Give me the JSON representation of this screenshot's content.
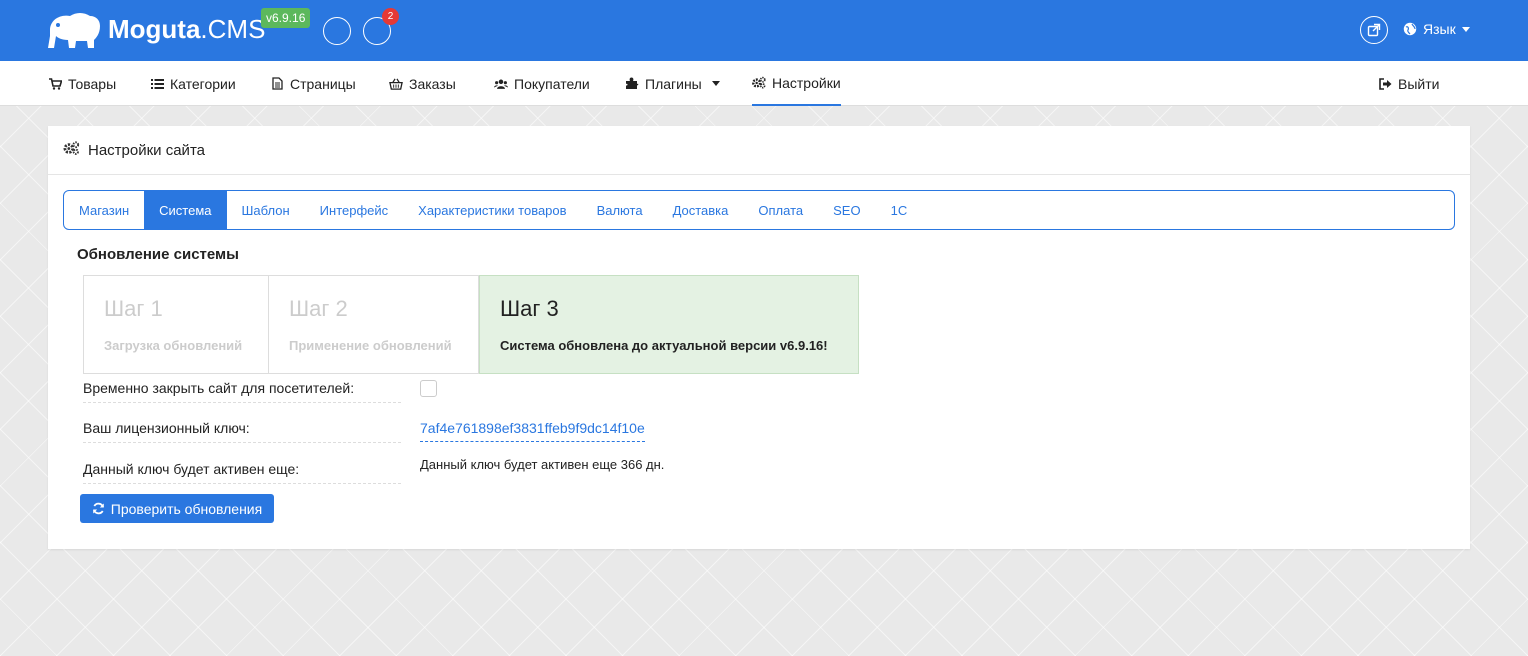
{
  "header": {
    "brand_bold": "Moguta",
    "brand_thin": ".CMS",
    "version": "v6.9.16",
    "notification_count": "2",
    "language_label": "Язык"
  },
  "nav": {
    "items": [
      {
        "label": "Товары",
        "icon": "cart-icon"
      },
      {
        "label": "Категории",
        "icon": "list-icon"
      },
      {
        "label": "Страницы",
        "icon": "file-icon"
      },
      {
        "label": "Заказы",
        "icon": "basket-icon"
      },
      {
        "label": "Покупатели",
        "icon": "users-icon"
      },
      {
        "label": "Плагины",
        "icon": "puzzle-icon"
      },
      {
        "label": "Настройки",
        "icon": "gears-icon"
      }
    ],
    "logout_label": "Выйти",
    "active": "Настройки"
  },
  "panel": {
    "title": "Настройки сайта",
    "tabs": [
      "Магазин",
      "Система",
      "Шаблон",
      "Интерфейс",
      "Характеристики товаров",
      "Валюта",
      "Доставка",
      "Оплата",
      "SEO",
      "1С"
    ],
    "active_tab": "Система",
    "section_title": "Обновление системы",
    "steps": [
      {
        "title": "Шаг 1",
        "subtitle": "Загрузка обновлений"
      },
      {
        "title": "Шаг 2",
        "subtitle": "Применение обновлений"
      },
      {
        "title": "Шаг 3",
        "subtitle": "Система обновлена до актуальной версии v6.9.16!"
      }
    ],
    "close_site_label": "Временно закрыть сайт для посетителей:",
    "close_site_checked": false,
    "license_label": "Ваш лицензионный ключ:",
    "license_key": "7af4e761898ef3831ffeb9f9dc14f10e",
    "active_label": "Данный ключ будет активен еще:",
    "active_value": "Данный ключ будет активен еще 366 дн.",
    "check_button": "Проверить обновления"
  },
  "colors": {
    "accent": "#2a77e0",
    "success_bg": "#e4f2e3",
    "badge": "#e53935",
    "version_badge": "#5cb85c"
  }
}
